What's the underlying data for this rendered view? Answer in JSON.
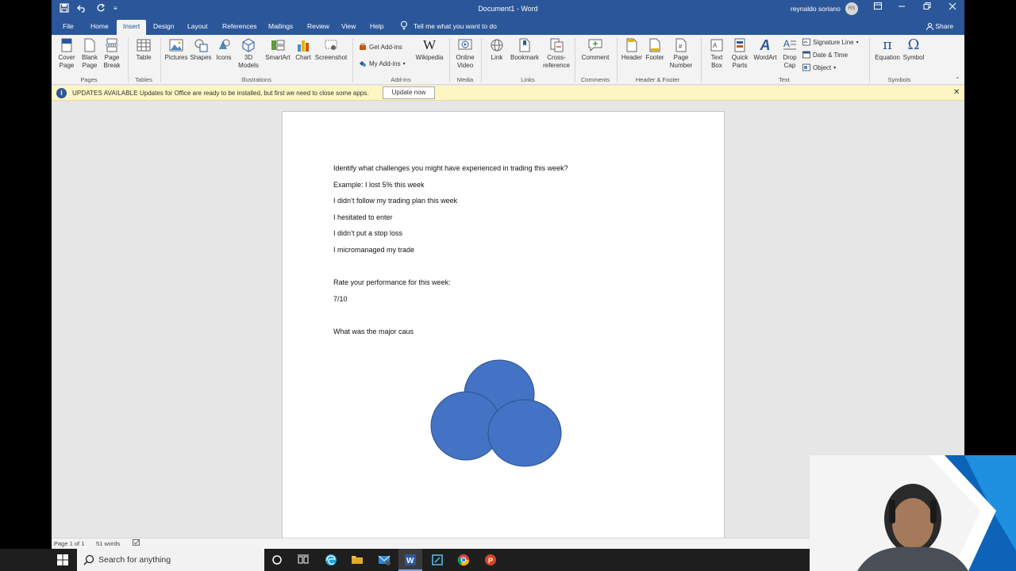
{
  "title_bar": {
    "document_title": "Document1  -  Word",
    "user_name": "reynaldo soriano",
    "user_initials": "RS"
  },
  "menu_tabs": [
    "File",
    "Home",
    "Insert",
    "Design",
    "Layout",
    "References",
    "Mailings",
    "Review",
    "View",
    "Help"
  ],
  "active_tab": "Insert",
  "tell_me": "Tell me what you want to do",
  "share": "Share",
  "ribbon": {
    "pages": {
      "cover_page": "Cover\nPage",
      "blank_page": "Blank\nPage",
      "page_break": "Page\nBreak",
      "group": "Pages"
    },
    "tables": {
      "table": "Table",
      "group": "Tables"
    },
    "illustrations": {
      "pictures": "Pictures",
      "shapes": "Shapes",
      "icons": "Icons",
      "models": "3D\nModels",
      "smartart": "SmartArt",
      "chart": "Chart",
      "screenshot": "Screenshot",
      "group": "Illustrations"
    },
    "addins": {
      "get_addins": "Get Add-ins",
      "my_addins": "My Add-ins",
      "wikipedia": "Wikipedia",
      "group": "Add-ins"
    },
    "media": {
      "online_video": "Online\nVideo",
      "group": "Media"
    },
    "links": {
      "link": "Link",
      "bookmark": "Bookmark",
      "cross_reference": "Cross-\nreference",
      "group": "Links"
    },
    "comments": {
      "comment": "Comment",
      "group": "Comments"
    },
    "header_footer": {
      "header": "Header",
      "footer": "Footer",
      "page_number": "Page\nNumber",
      "group": "Header & Footer"
    },
    "text": {
      "text_box": "Text\nBox",
      "quick_parts": "Quick\nParts",
      "wordart": "WordArt",
      "drop_cap": "Drop\nCap",
      "signature_line": "Signature Line",
      "date_time": "Date & Time",
      "object": "Object",
      "group": "Text"
    },
    "symbols": {
      "equation": "Equation",
      "symbol": "Symbol",
      "group": "Symbols"
    }
  },
  "infobar": {
    "title": "UPDATES AVAILABLE",
    "message": "Updates for Office are ready to be installed, but first we need to close some apps.",
    "button": "Update now"
  },
  "document": {
    "lines": [
      "Identify what challenges you might have experienced in trading this week?",
      "Example: I lost 5% this week",
      "I didn’t follow my trading plan this week",
      "I hesitated to enter",
      "I didn’t put a stop loss",
      "I micromanaged my trade",
      "Rate your performance for this week:",
      "7/10",
      "What was the major caus"
    ],
    "shape_color": "#4472c4"
  },
  "status_bar": {
    "page": "Page 1 of 1",
    "words": "51 words"
  },
  "taskbar": {
    "search_placeholder": "Search for anything"
  },
  "colors": {
    "word_blue": "#2b579a",
    "infobar_bg": "#fdf6c2"
  }
}
